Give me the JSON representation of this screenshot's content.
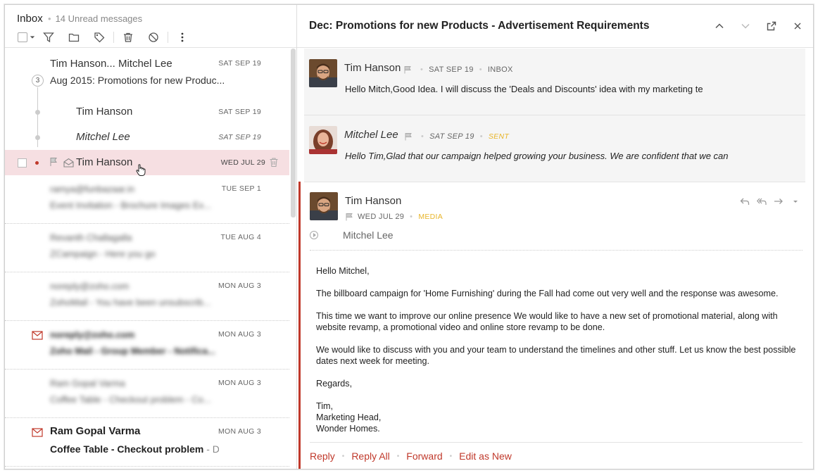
{
  "list": {
    "title": "Inbox",
    "unread": "14 Unread messages",
    "thread": {
      "senders": "Tim Hanson... Mitchel Lee",
      "date": "SAT SEP 19",
      "count": "3",
      "subject": "Aug 2015: Promotions for new Produc...",
      "children": [
        {
          "name": "Tim Hanson",
          "date": "SAT SEP 19"
        },
        {
          "name": "Mitchel Lee",
          "date": "SAT SEP 19"
        }
      ]
    },
    "selected": {
      "name": "Tim Hanson",
      "date": "WED JUL 29"
    },
    "rows": [
      {
        "sender": "ramya@funbazaar.in",
        "date": "TUE SEP 1",
        "subject": "Event Invitation - Brochure Images Ex..."
      },
      {
        "sender": "Revanth Challagalla",
        "date": "TUE AUG 4",
        "subject": "ZCampaign - Here you go"
      },
      {
        "sender": "noreply@zoho.com",
        "date": "MON AUG 3",
        "subject": "ZohoMail - You have been unsubscrib..."
      },
      {
        "sender": "noreply@zoho.com",
        "date": "MON AUG 3",
        "subject": "Zoho Mail - Group Member - Notifica..."
      },
      {
        "sender": "Ram Gopal Varma",
        "date": "MON AUG 3",
        "subject": "Coffee Table - Checkout problem - Co..."
      },
      {
        "sender": "Ram Gopal Varma",
        "date": "MON AUG 3",
        "subject": "Coffee Table - Checkout problem",
        "subject_rest": " - D..."
      }
    ]
  },
  "reader": {
    "title": "Dec: Promotions for new Products - Advertisement Requirements",
    "msg1": {
      "from": "Tim Hanson",
      "date": "SAT SEP 19",
      "folder": "INBOX",
      "preview": "Hello Mitch,Good Idea. I will discuss the 'Deals and Discounts' idea with my marketing te"
    },
    "msg2": {
      "from": "Mitchel Lee",
      "date": "SAT SEP 19",
      "tag": "SENT",
      "preview": "Hello Tim,Glad that our campaign helped growing your business. We are confident that we can"
    },
    "open": {
      "from": "Tim Hanson",
      "date": "WED JUL 29",
      "tag": "MEDIA",
      "to": "Mitchel Lee",
      "body": {
        "greeting": "Hello Mitchel,",
        "p1": "The billboard campaign for 'Home Furnishing' during the Fall had come out very well and the response was awesome.",
        "p2": "This time we want to improve our online presence We would like to have a new set of promotional material, along with website revamp, a promotional video and online store revamp to be done.",
        "p3": "We would like to discuss with you and your team to understand the timelines and other stuff. Let us know the best possible dates next week for meeting.",
        "regards": "Regards,",
        "sig1": "Tim,",
        "sig2": "Marketing Head,",
        "sig3": "Wonder Homes."
      },
      "actions": {
        "reply": "Reply",
        "reply_all": "Reply All",
        "forward": "Forward",
        "edit": "Edit as New"
      }
    }
  },
  "colors": {
    "accent": "#c0392b",
    "selected_row": "#f6dfe2",
    "tag": "#e8b52a"
  }
}
